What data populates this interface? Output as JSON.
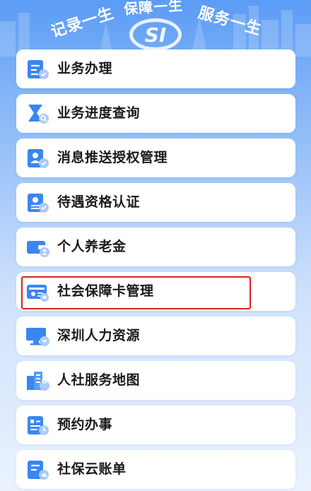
{
  "header": {
    "slogan_left": "记录一生",
    "slogan_middle": "保障一生",
    "slogan_right": "服务一生",
    "logo_text": "SI"
  },
  "menu": {
    "items": [
      {
        "label": "业务办理",
        "icon": "business-handling-icon"
      },
      {
        "label": "业务进度查询",
        "icon": "progress-query-icon"
      },
      {
        "label": "消息推送授权管理",
        "icon": "message-authorization-icon"
      },
      {
        "label": "待遇资格认证",
        "icon": "qualification-certification-icon"
      },
      {
        "label": "个人养老金",
        "icon": "personal-pension-icon"
      },
      {
        "label": "社会保障卡管理",
        "icon": "social-security-card-icon"
      },
      {
        "label": "深圳人力资源",
        "icon": "human-resources-icon"
      },
      {
        "label": "人社服务地图",
        "icon": "service-map-icon"
      },
      {
        "label": "预约办事",
        "icon": "appointment-icon"
      },
      {
        "label": "社保云账单",
        "icon": "cloud-bill-icon"
      }
    ],
    "highlighted_item": "社会保障卡管理"
  },
  "colors": {
    "accent": "#3a86f0",
    "highlight_border": "#e02020",
    "background_top": "#5b9cf5"
  }
}
